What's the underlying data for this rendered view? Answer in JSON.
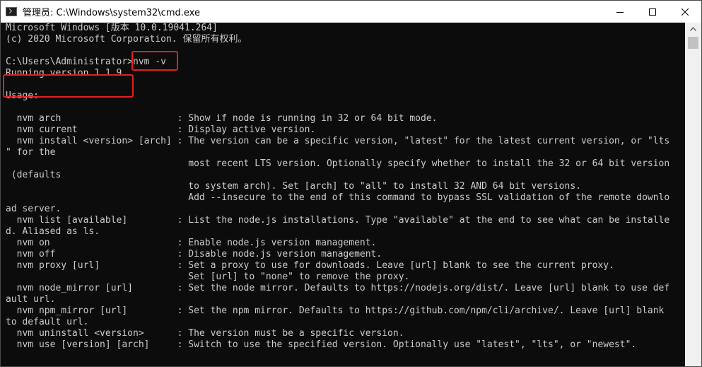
{
  "window": {
    "title": "管理员: C:\\Windows\\system32\\cmd.exe",
    "app_icon": "cmd-icon",
    "caption_buttons": [
      "minimize-icon",
      "maximize-icon",
      "close-icon"
    ]
  },
  "console": {
    "lines": [
      "Microsoft Windows [版本 10.0.19041.264]",
      "(c) 2020 Microsoft Corporation. 保留所有权利。",
      "",
      "C:\\Users\\Administrator>nvm -v",
      "Running version 1.1.9.",
      "",
      "Usage:",
      "",
      "  nvm arch                     : Show if node is running in 32 or 64 bit mode.",
      "  nvm current                  : Display active version.",
      "  nvm install <version> [arch] : The version can be a specific version, \"latest\" for the latest current version, or \"lts",
      "\" for the",
      "                                 most recent LTS version. Optionally specify whether to install the 32 or 64 bit version",
      " (defaults",
      "                                 to system arch). Set [arch] to \"all\" to install 32 AND 64 bit versions.",
      "                                 Add --insecure to the end of this command to bypass SSL validation of the remote downlo",
      "ad server.",
      "  nvm list [available]         : List the node.js installations. Type \"available\" at the end to see what can be installe",
      "d. Aliased as ls.",
      "  nvm on                       : Enable node.js version management.",
      "  nvm off                      : Disable node.js version management.",
      "  nvm proxy [url]              : Set a proxy to use for downloads. Leave [url] blank to see the current proxy.",
      "                                 Set [url] to \"none\" to remove the proxy.",
      "  nvm node_mirror [url]        : Set the node mirror. Defaults to https://nodejs.org/dist/. Leave [url] blank to use def",
      "ault url.",
      "  nvm npm_mirror [url]         : Set the npm mirror. Defaults to https://github.com/npm/cli/archive/. Leave [url] blank",
      "to default url.",
      "  nvm uninstall <version>      : The version must be a specific version.",
      "  nvm use [version] [arch]     : Switch to use the specified version. Optionally use \"latest\", \"lts\", or \"newest\"."
    ]
  },
  "colors": {
    "console_bg": "#0c0c0c",
    "console_fg": "#cccccc",
    "highlight": "#e02020",
    "titlebar_bg": "#ffffff"
  }
}
